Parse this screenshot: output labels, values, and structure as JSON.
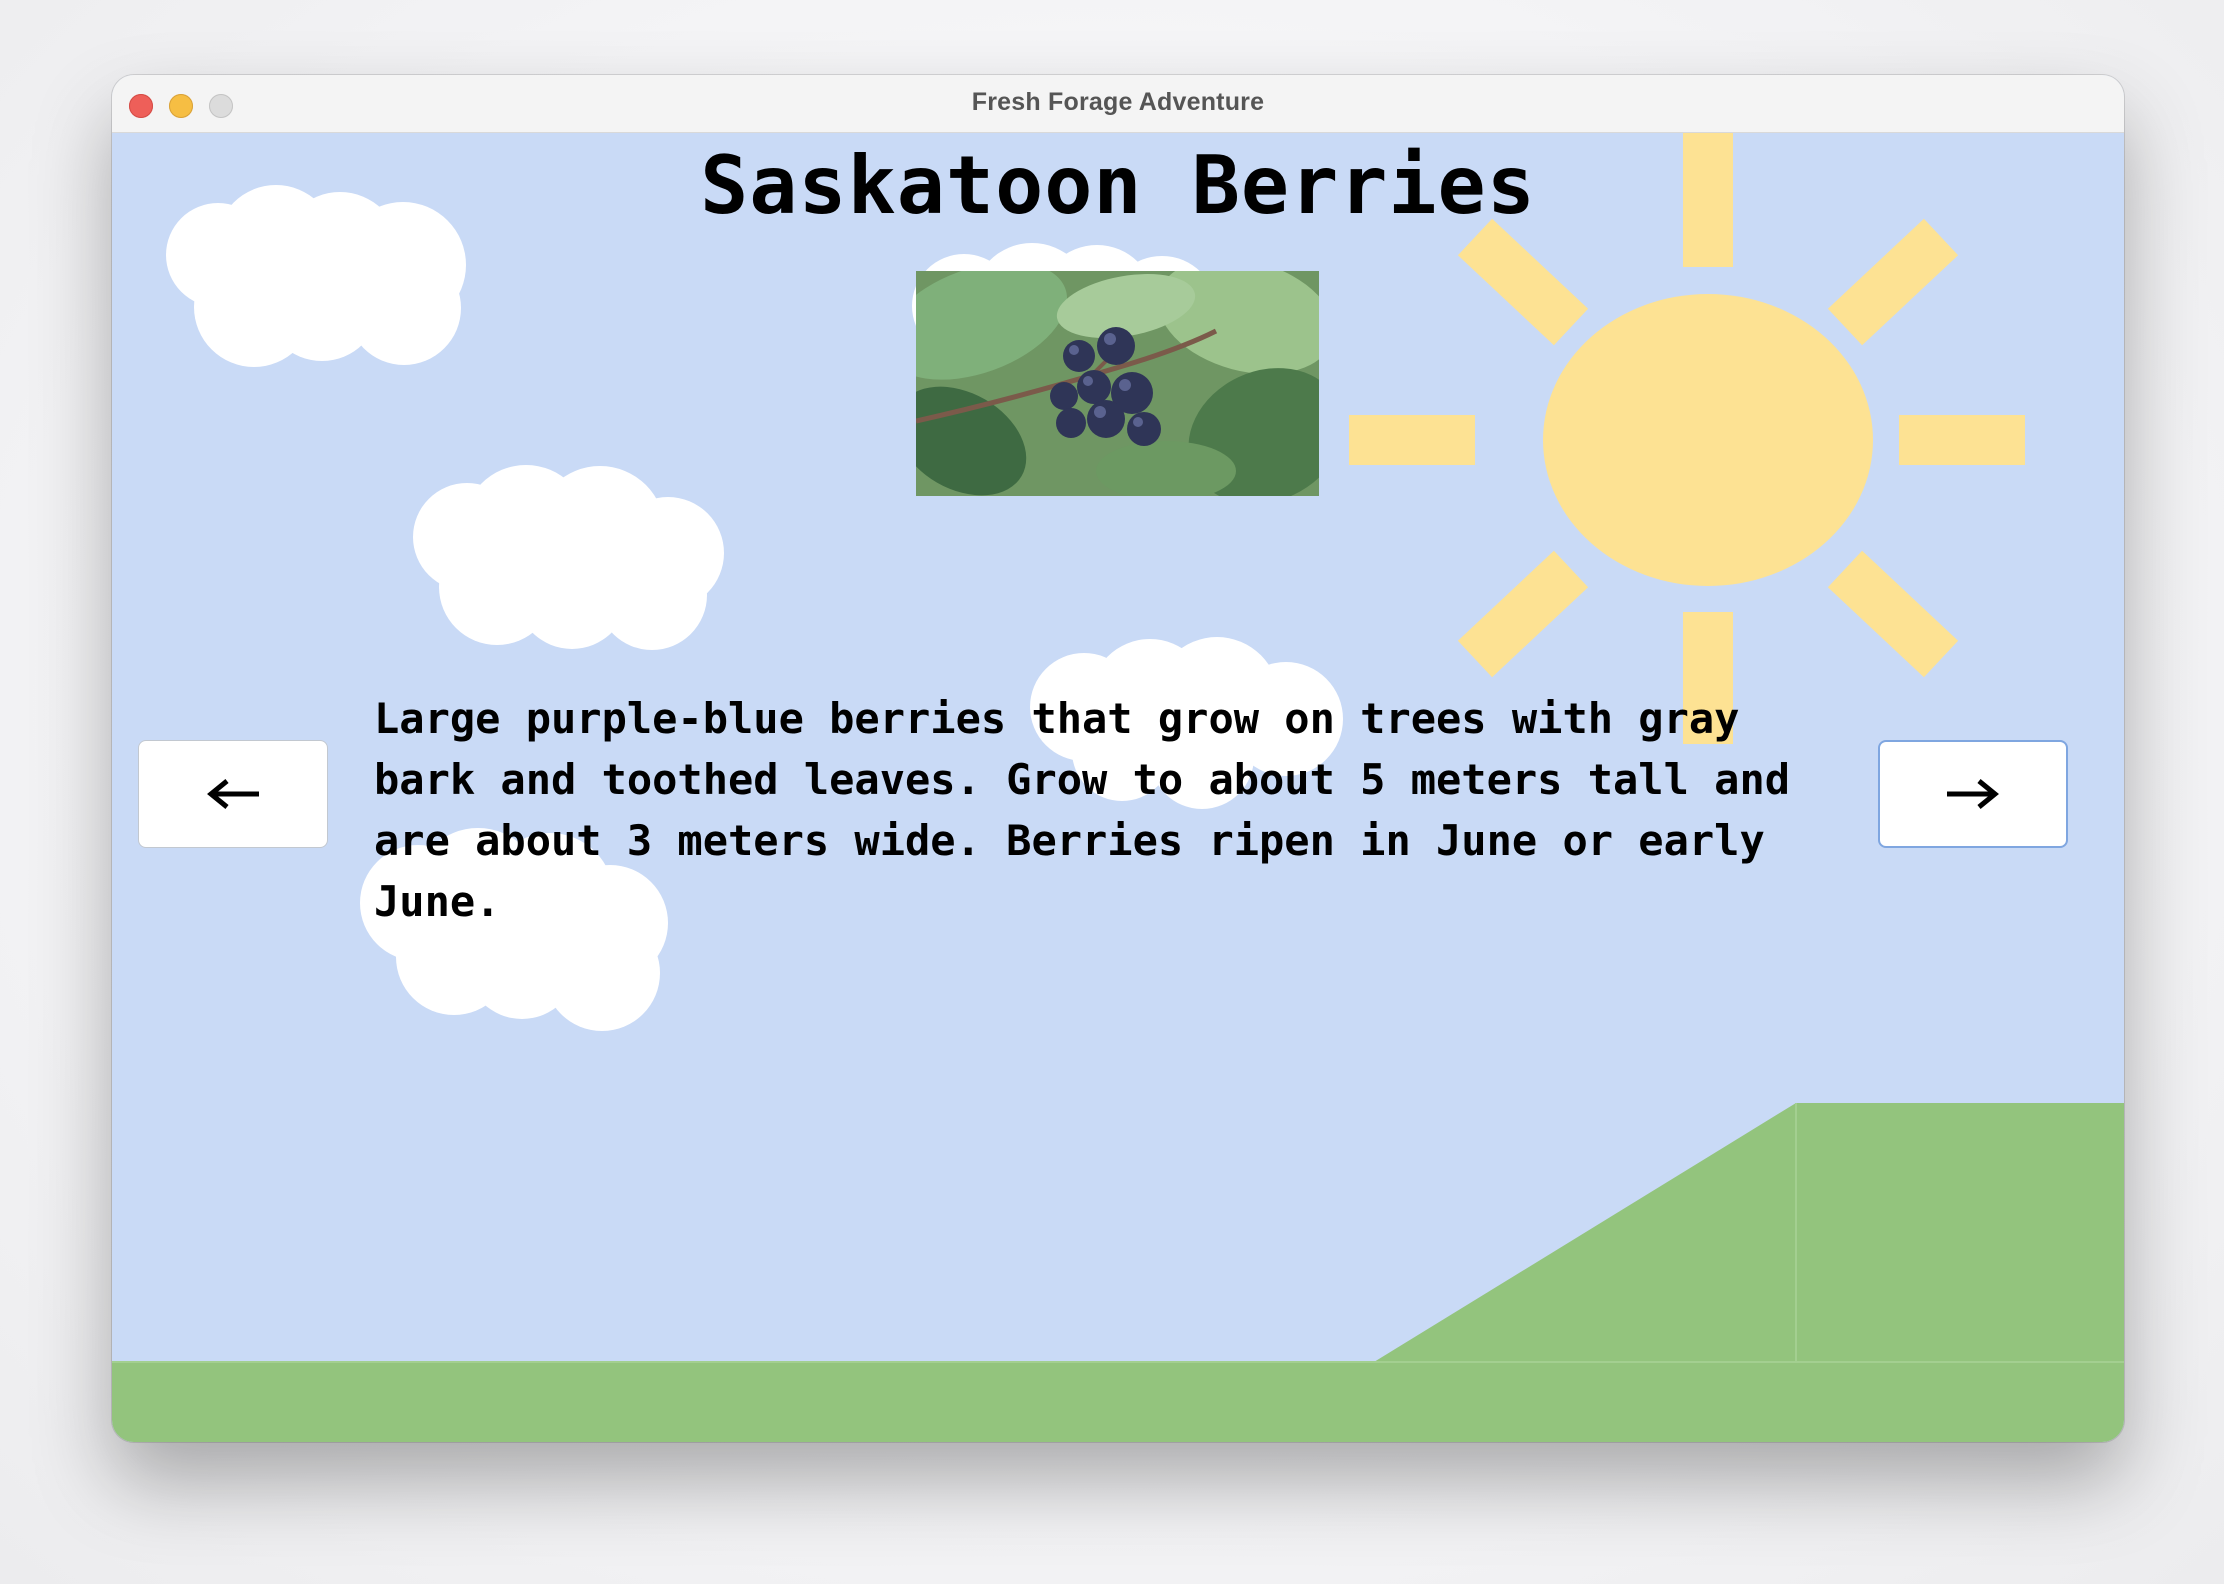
{
  "window": {
    "title": "Fresh Forage Adventure"
  },
  "page": {
    "heading": "Saskatoon Berries",
    "description": "Large purple-blue berries that grow on trees with gray bark and toothed leaves. Grow to about 5 meters tall and are about 3 meters wide. Berries ripen in June or early June."
  },
  "navigation": {
    "previous_icon": "arrow-left-icon",
    "next_icon": "arrow-right-icon"
  },
  "colors": {
    "sky": "#c9daf6",
    "sun": "#fde293",
    "grass": "#93c47d",
    "cloud": "#ffffff"
  }
}
